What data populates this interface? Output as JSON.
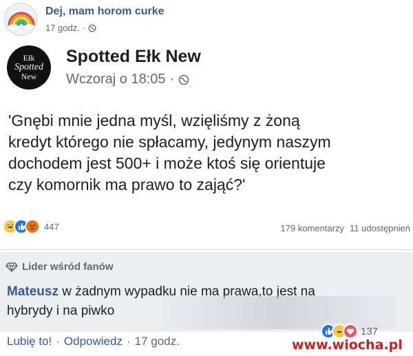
{
  "outer_post": {
    "page_name": "Dej, mam horom curke",
    "time": "17 godz.",
    "separator": "·"
  },
  "shared_post": {
    "logo_lines": [
      "Ełk",
      "Spotted",
      "New"
    ],
    "page_name": "Spotted Ełk New",
    "time": "Wczoraj o 18:05",
    "separator": "·",
    "text_lines": [
      "'Gnębi mnie jedna myśl, wzięliśmy z żoną",
      "kredyt którego nie spłacamy, jedynym naszym",
      "dochodem jest 500+ i  może ktoś się orientuje",
      "czy komornik ma prawo to zająć?'"
    ],
    "reaction_count": "447",
    "comments": "179 komentarzy",
    "shares": "11 udostępnień"
  },
  "comment": {
    "badge": "Lider wśród fanów",
    "author": "Mateusz",
    "text_line1": " w żadnym wypadku nie ma prawa,to jest na",
    "text_line2": "hybrydy i na piwko",
    "like_action": "Lubię to!",
    "reply_action": "Odpowiedz",
    "time": "17 godz.",
    "separator": "·",
    "reaction_count": "137"
  },
  "watermark": "www.wiocha.pl",
  "colors": {
    "link_blue": "#385898",
    "meta_gray": "#606770",
    "comment_bg": "#eceef2",
    "watermark_red": "#c32127"
  }
}
